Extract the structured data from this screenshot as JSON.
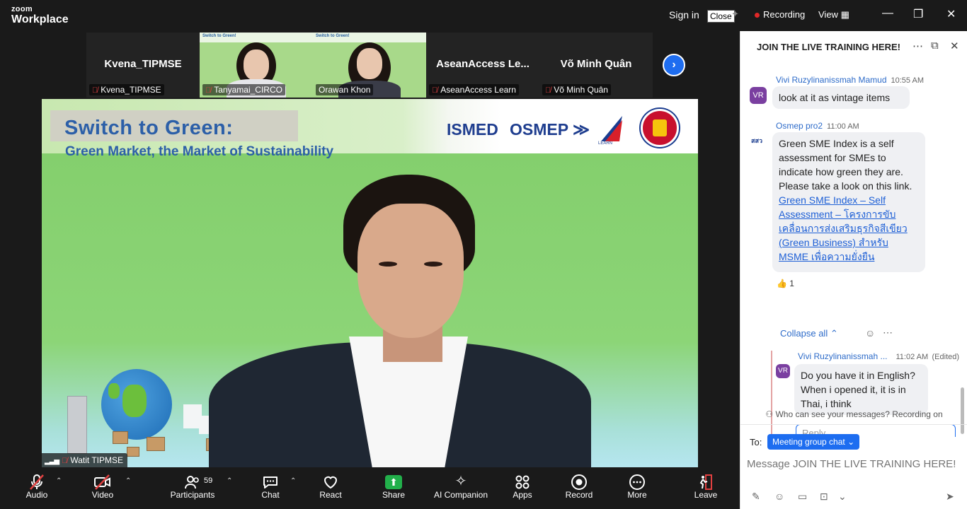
{
  "app": {
    "brand_top": "zoom",
    "brand_bottom": "Workplace"
  },
  "topbar": {
    "sign_in": "Sign in",
    "close_tooltip": "Close",
    "recording": "Recording",
    "view": "View",
    "minimize_icon": "minimize-icon",
    "restore_icon": "restore-icon",
    "close_icon": "close-icon"
  },
  "thumbnails": [
    {
      "tile": "Kvena_TIPMSE",
      "label": "Kvena_TIPMSE",
      "muted": true,
      "video": false
    },
    {
      "tile": "",
      "label": "Tanyamai_CIRCO",
      "muted": true,
      "video": true
    },
    {
      "tile": "",
      "label": "Orawan Khon",
      "muted": false,
      "video": true
    },
    {
      "tile": "AseanAccess  Le...",
      "label": "AseanAccess Learn",
      "muted": true,
      "video": false
    },
    {
      "tile": "Võ Minh Quân",
      "label": "Võ Minh Quân",
      "muted": true,
      "video": false
    }
  ],
  "thumb_slide_text": "Switch to Green!",
  "slide": {
    "title": "Switch to Green:",
    "subtitle": "Green Market, the Market of Sustainability",
    "logo_1": "ISMED",
    "logo_2": "OSMEP",
    "logo_3_caption": "LEARN"
  },
  "main_speaker": {
    "name": "Watit TIPMSE"
  },
  "toolbar": {
    "audio": "Audio",
    "video": "Video",
    "participants": "Participants",
    "participants_count": "59",
    "chat": "Chat",
    "react": "React",
    "share": "Share",
    "ai_companion": "AI Companion",
    "apps": "Apps",
    "record": "Record",
    "more": "More",
    "leave": "Leave"
  },
  "chat": {
    "title": "JOIN THE LIVE TRAINING HERE!",
    "messages": [
      {
        "avatar": "VR",
        "sender": "Vivi Ruzylinanissmah Mamud",
        "time": "10:55 AM",
        "text": "look at it as vintage items"
      },
      {
        "avatar": "สสว",
        "sender": "Osmep pro2",
        "time": "11:00 AM",
        "text": "Green SME Index is a self assessment for SMEs to indicate how green they are. Please take a look on this link.",
        "link": "Green SME Index – Self Assessment – โครงการขับเคลื่อนการส่งเสริมธุรกิจสีเขียว (Green Business) สำหรับ MSME เพื่อความยั่งยืน",
        "reaction_emoji": "👍",
        "reaction_count": "1"
      }
    ],
    "collapse_all": "Collapse all",
    "reply": {
      "avatar": "VR",
      "sender": "Vivi Ruzylinanissmah ...",
      "time": "11:02 AM",
      "edited": "(Edited)",
      "text": "Do you have it in English? When i opened it, it is in Thai, i think"
    },
    "reply_placeholder": "Reply...",
    "who_can_see": "Who can see your messages? Recording on",
    "to_label": "To:",
    "to_target": "Meeting group chat",
    "input_placeholder": "Message JOIN THE LIVE TRAINING HERE!"
  },
  "colors": {
    "accent": "#1d6df0",
    "recording": "#e02828",
    "slide_green": "#8fd36b",
    "slide_title": "#2c5fa8",
    "share_green": "#22b04b"
  }
}
